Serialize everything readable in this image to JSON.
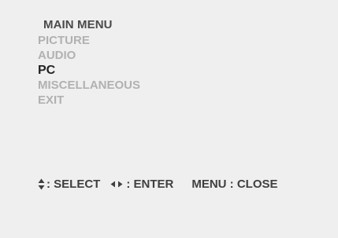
{
  "menu": {
    "title": "MAIN MENU",
    "items": [
      {
        "label": "PICTURE",
        "selected": false
      },
      {
        "label": "AUDIO",
        "selected": false
      },
      {
        "label": "PC",
        "selected": true
      },
      {
        "label": "MISCELLANEOUS",
        "selected": false
      },
      {
        "label": "EXIT",
        "selected": false
      }
    ]
  },
  "help": {
    "select_icon": "up-down-arrows-icon",
    "select_label": ": SELECT",
    "enter_icon": "left-right-arrows-icon",
    "enter_label": ": ENTER",
    "close_label": "MENU : CLOSE"
  },
  "colors": {
    "background": "#efefef",
    "selected_text": "#222222",
    "inactive_text": "#b1b1b1",
    "help_text": "#3f3f3f"
  }
}
